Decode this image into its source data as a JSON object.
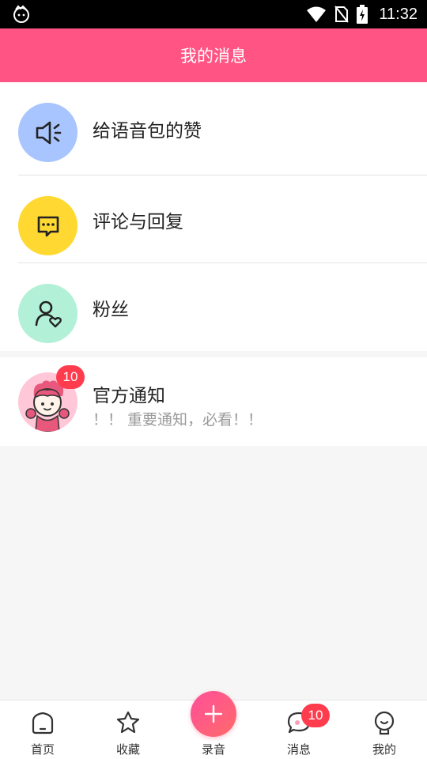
{
  "status_bar": {
    "time": "11:32"
  },
  "header": {
    "title": "我的消息"
  },
  "rows": [
    {
      "label": "给语音包的赞",
      "icon": "speaker-icon",
      "color": "#a9c5ff"
    },
    {
      "label": "评论与回复",
      "icon": "chat-bubble-icon",
      "color": "#ffd932"
    },
    {
      "label": "粉丝",
      "icon": "person-heart-icon",
      "color": "#b2f0d8"
    }
  ],
  "notice": {
    "title": "官方通知",
    "subtitle": "！！ 重要通知，必看！！",
    "badge": "10",
    "avatar_color": "#ffc7d7"
  },
  "tabs": [
    {
      "label": "首页",
      "icon": "home-icon"
    },
    {
      "label": "收藏",
      "icon": "star-icon"
    },
    {
      "label": "录音",
      "icon": "plus-icon"
    },
    {
      "label": "消息",
      "icon": "message-icon",
      "badge": "10"
    },
    {
      "label": "我的",
      "icon": "profile-icon"
    }
  ],
  "colors": {
    "accent": "#ff5484",
    "badge": "#ff3b4e"
  }
}
